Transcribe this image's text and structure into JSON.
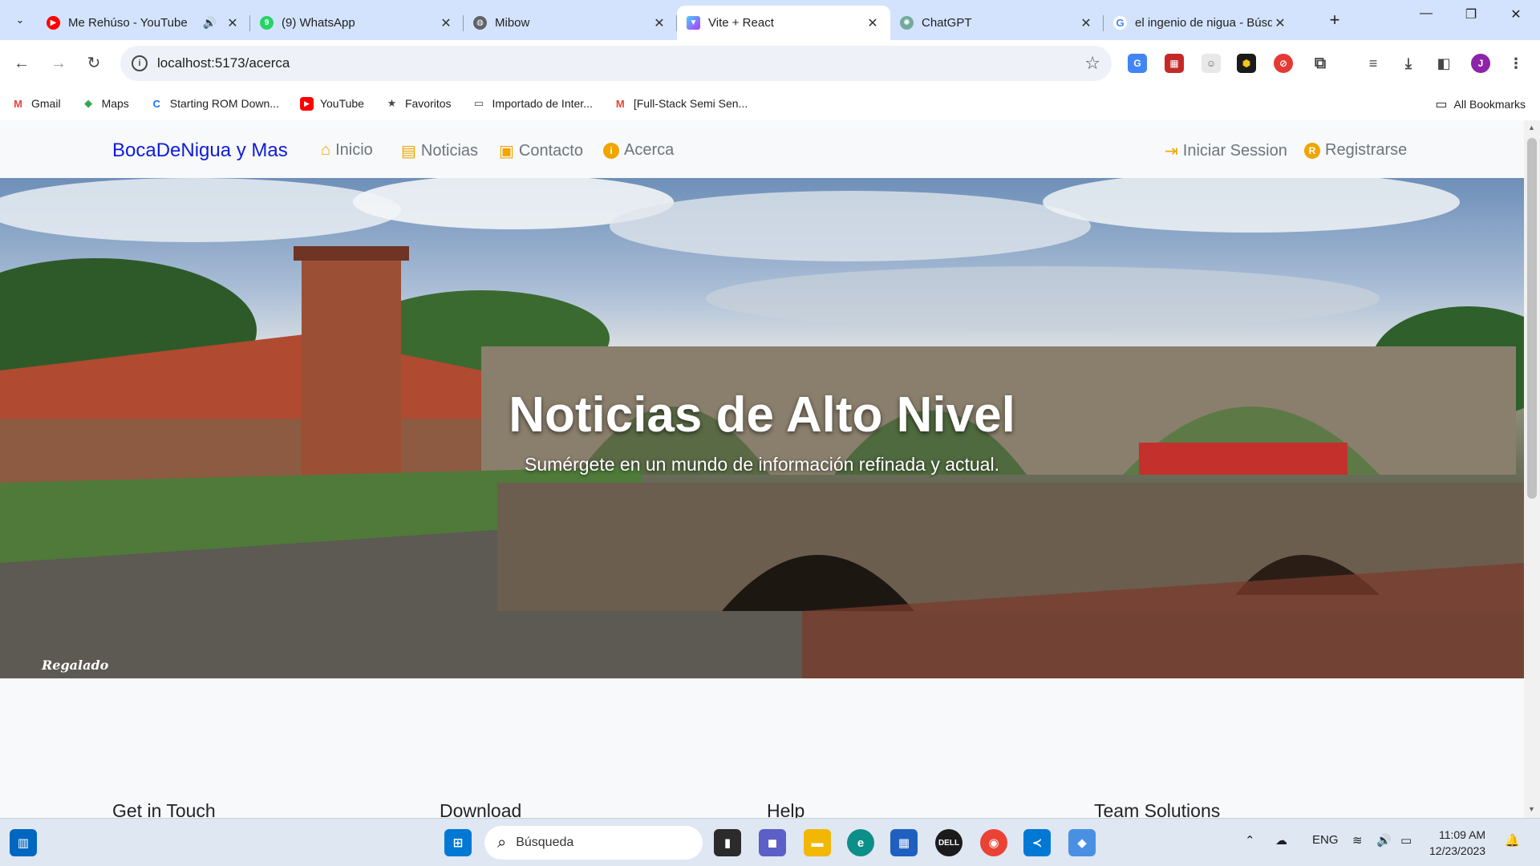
{
  "tabs": [
    {
      "title": "Me Rehúso - YouTube",
      "favicon": "youtube-icon",
      "audio": true,
      "active": false
    },
    {
      "title": "(9) WhatsApp",
      "favicon": "whatsapp-icon",
      "audio": false,
      "active": false
    },
    {
      "title": "Mibow",
      "favicon": "globe-icon",
      "audio": false,
      "active": false
    },
    {
      "title": "Vite + React",
      "favicon": "vite-icon",
      "audio": false,
      "active": true
    },
    {
      "title": "ChatGPT",
      "favicon": "chatgpt-icon",
      "audio": false,
      "active": false
    },
    {
      "title": "el ingenio de nigua - Búsq",
      "favicon": "google-icon",
      "audio": false,
      "active": false
    }
  ],
  "toolbar": {
    "url": "localhost:5173/acerca"
  },
  "bookmarks": [
    {
      "label": "Gmail",
      "icon": "gmail-icon"
    },
    {
      "label": "Maps",
      "icon": "maps-icon"
    },
    {
      "label": "Starting ROM Down...",
      "icon": "c-icon"
    },
    {
      "label": "YouTube",
      "icon": "youtube-icon"
    },
    {
      "label": "Favoritos",
      "icon": "star-icon"
    },
    {
      "label": "Importado de Inter...",
      "icon": "folder-icon"
    },
    {
      "label": "[Full-Stack Semi Sen...",
      "icon": "gmail-icon"
    }
  ],
  "bookmarks_all": "All Bookmarks",
  "site": {
    "brand": "BocaDeNigua y Mas",
    "nav": {
      "inicio": "Inicio",
      "noticias": "Noticias",
      "contacto": "Contacto",
      "acerca": "Acerca",
      "login": "Iniciar Session",
      "register": "Registrarse"
    },
    "hero": {
      "title": "Noticias de Alto Nivel",
      "subtitle": "Sumérgete en un mundo de información refinada y actual.",
      "signature": "Regalado"
    },
    "footer_headings": [
      "Get in Touch",
      "Download",
      "Help",
      "Team Solutions"
    ]
  },
  "taskbar": {
    "search_placeholder": "Búsqueda",
    "language": "ENG",
    "time": "11:09 AM",
    "date": "12/23/2023"
  },
  "profile_initial": "J",
  "colors": {
    "brand": "#0d1cdb",
    "nav_icon": "#f0a500",
    "nav_text": "#6c757d"
  }
}
